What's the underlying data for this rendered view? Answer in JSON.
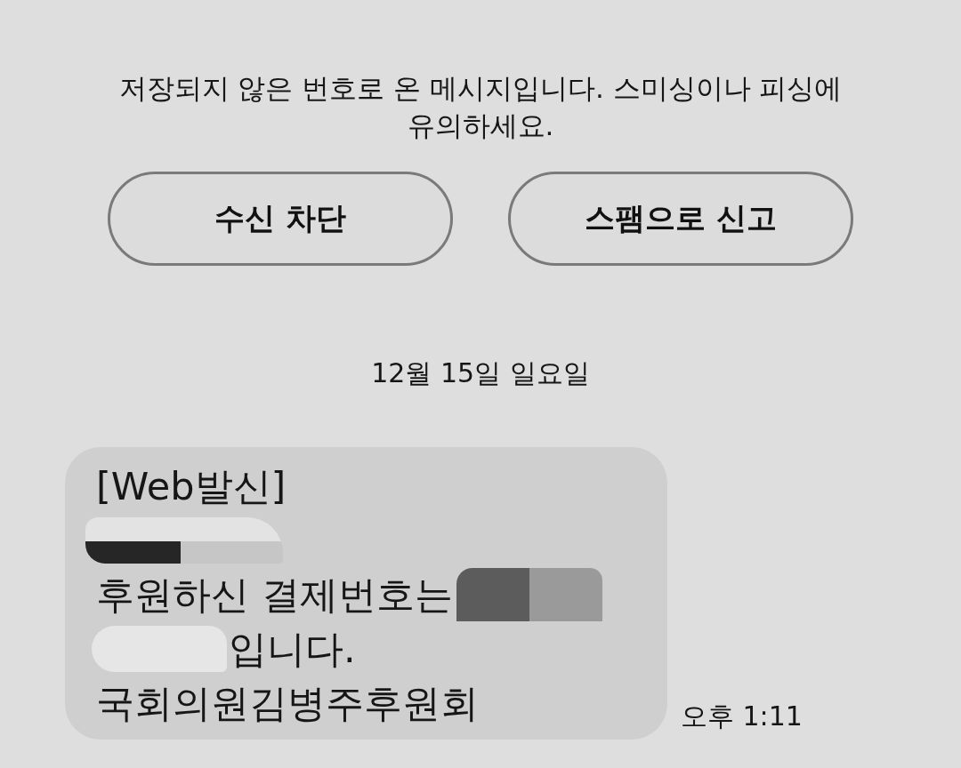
{
  "notice": {
    "text": "저장되지 않은 번호로 온 메시지입니다. 스미싱이나 피싱에 유의하세요."
  },
  "actions": [
    {
      "label": "수신 차단"
    },
    {
      "label": "스팸으로 신고"
    }
  ],
  "date_divider": {
    "text": "12월 15일 일요일"
  },
  "message": {
    "lines": [
      {
        "segments": [
          {
            "kind": "text",
            "text": "[Web발신]"
          }
        ]
      },
      {
        "segments": [
          {
            "kind": "tear"
          }
        ]
      },
      {
        "segments": [
          {
            "kind": "text",
            "text": "후원하신 결제번호는"
          },
          {
            "kind": "patch"
          }
        ]
      },
      {
        "segments": [
          {
            "kind": "blot"
          },
          {
            "kind": "text",
            "text": "입니다."
          }
        ]
      },
      {
        "segments": [
          {
            "kind": "text",
            "text": "국회의원김병주후원회"
          }
        ]
      }
    ],
    "time": "오후 1:11"
  }
}
